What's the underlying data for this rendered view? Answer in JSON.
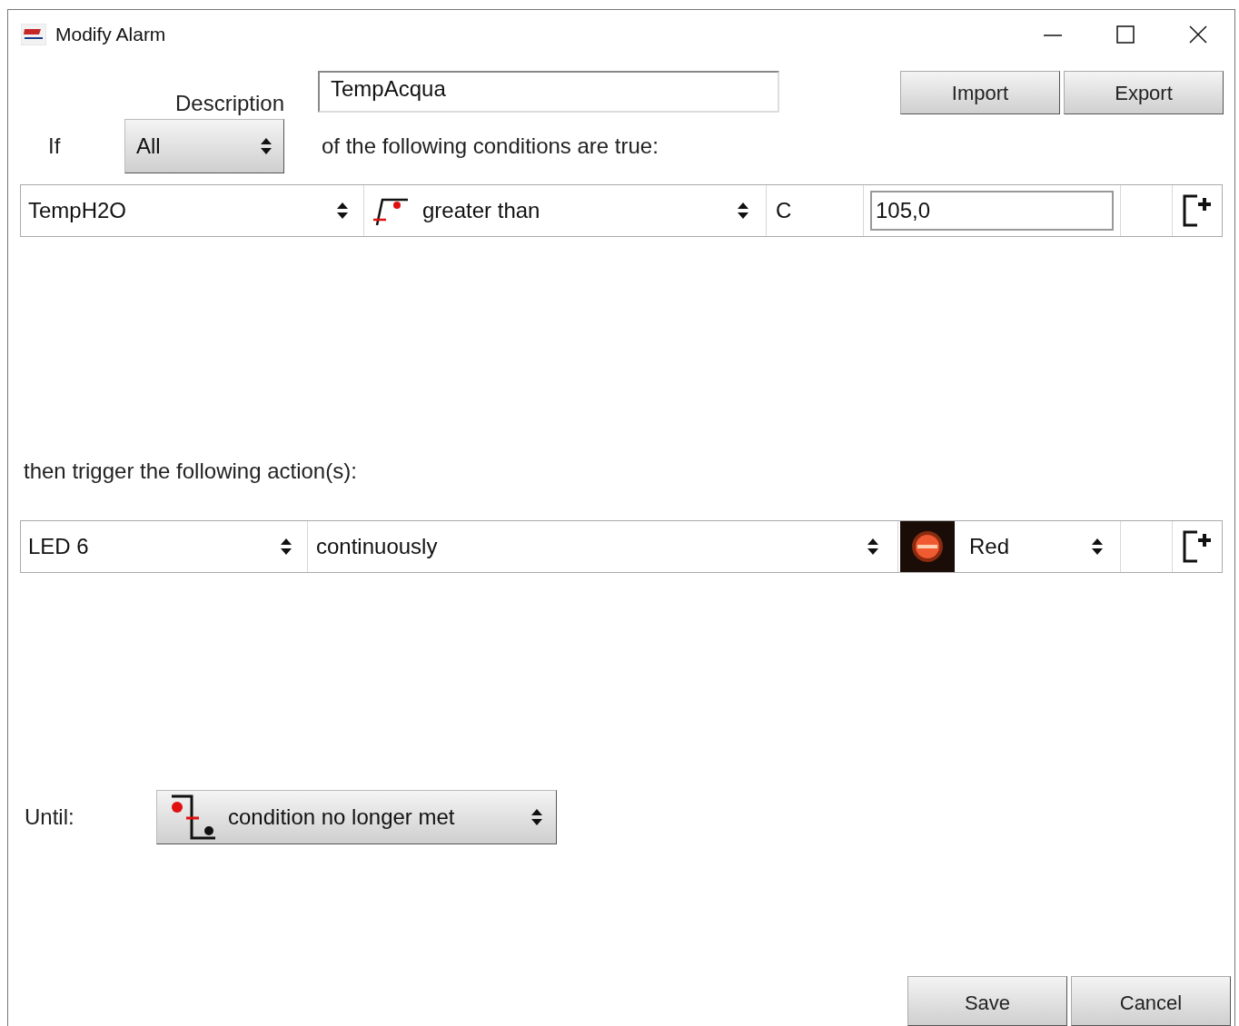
{
  "window": {
    "title": "Modify Alarm"
  },
  "description": {
    "label": "Description",
    "value": "TempAcqua"
  },
  "toolbar_buttons": [
    "Import",
    "Export"
  ],
  "match": {
    "label": "If",
    "value": "All",
    "suffix": "of the following conditions are true:"
  },
  "conditions": [
    {
      "channel": "TempH2O",
      "operator": "greater than",
      "unit": "C",
      "value": "105,0"
    }
  ],
  "actions_label": "then trigger the following action(s):",
  "actions": [
    {
      "output": "LED 6",
      "mode": "continuously",
      "led_color": "Red"
    }
  ],
  "until": {
    "label": "Until:",
    "value": "condition no longer met"
  },
  "buttons": [
    "Save",
    "Cancel"
  ]
}
